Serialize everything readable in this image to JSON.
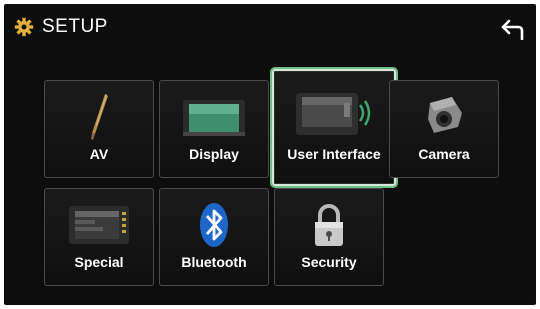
{
  "header": {
    "title": "SETUP",
    "settings_icon": "gear-icon",
    "back_icon": "back-arrow-icon"
  },
  "menu": {
    "selected": "User Interface",
    "items": [
      {
        "label": "AV",
        "icon": "av-icon"
      },
      {
        "label": "Display",
        "icon": "display-icon"
      },
      {
        "label": "User Interface",
        "icon": "user-interface-icon"
      },
      {
        "label": "Camera",
        "icon": "camera-icon"
      },
      {
        "label": "Special",
        "icon": "special-icon"
      },
      {
        "label": "Bluetooth",
        "icon": "bluetooth-icon"
      },
      {
        "label": "Security",
        "icon": "security-icon"
      }
    ]
  },
  "colors": {
    "screen_background": "#0d0d0d",
    "tile_border": "#4b4b4b",
    "selection_highlight": "#6fbf84",
    "text": "#ffffff"
  }
}
